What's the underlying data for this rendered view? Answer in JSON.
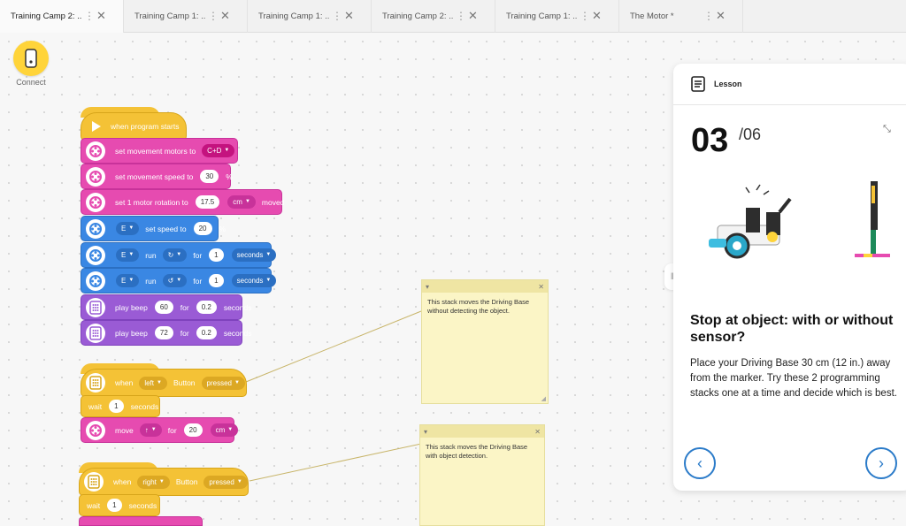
{
  "tabs": [
    {
      "label": "Training Camp 2: ..."
    },
    {
      "label": "Training Camp 1: ..."
    },
    {
      "label": "Training Camp 1: ..."
    },
    {
      "label": "Training Camp 2: ..."
    },
    {
      "label": "Training Camp 1: ..."
    },
    {
      "label": "The Motor *"
    }
  ],
  "tab_more_icon": "⋮",
  "tab_close_icon": "✕",
  "connect": {
    "label": "Connect"
  },
  "blocks": {
    "when_program_starts": "when program starts",
    "set_motors": {
      "label": "set movement motors to",
      "value": "C+D"
    },
    "set_speed": {
      "label": "set movement speed to",
      "value": "30",
      "unit": "%"
    },
    "set_rotation": {
      "label": "set 1 motor rotation to",
      "value": "17.5",
      "unit": "cm",
      "suffix": "moved"
    },
    "motor_speed": {
      "port": "E",
      "label": "set speed to",
      "value": "20",
      "unit": "%"
    },
    "run1": {
      "port": "E",
      "label": "run",
      "for": "for",
      "value": "1",
      "unit": "seconds"
    },
    "run2": {
      "port": "E",
      "label": "run",
      "for": "for",
      "value": "1",
      "unit": "seconds"
    },
    "beep1": {
      "label": "play beep",
      "note": "60",
      "for": "for",
      "value": "0.2",
      "unit": "seconds"
    },
    "beep2": {
      "label": "play beep",
      "note": "72",
      "for": "for",
      "value": "0.2",
      "unit": "seconds"
    },
    "when_left": {
      "when": "when",
      "side": "left",
      "button": "Button",
      "state": "pressed"
    },
    "wait1": {
      "label": "wait",
      "value": "1",
      "unit": "seconds"
    },
    "move": {
      "label": "move",
      "for": "for",
      "value": "20",
      "unit": "cm"
    },
    "when_right": {
      "when": "when",
      "side": "right",
      "button": "Button",
      "state": "pressed"
    },
    "wait2": {
      "label": "wait",
      "value": "1",
      "unit": "seconds"
    }
  },
  "notes": [
    {
      "text": "This stack moves the Driving Base without detecting the object."
    },
    {
      "text": "This stack moves the Driving Base with object detection."
    }
  ],
  "lesson": {
    "header": "Lesson",
    "step": "03",
    "total": "/06",
    "title": "Stop at object: with or without sensor?",
    "body": "Place your Driving Base 30 cm (12 in.) away from the marker. Try these 2 programming stacks one at a time and decide which is best.",
    "prev_icon": "‹",
    "next_icon": "›"
  },
  "colors": {
    "event_yellow": "#f4c236",
    "movement_pink": "#e64bb0",
    "motor_blue": "#3a87e3",
    "sound_purple": "#9a5bd5",
    "note_yellow": "#fbf5c6",
    "nav_blue": "#2b7bc9"
  }
}
